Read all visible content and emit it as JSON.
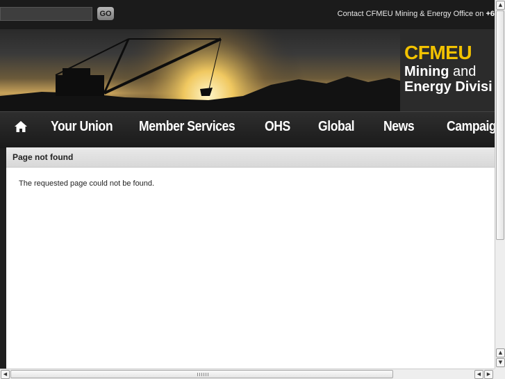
{
  "topbar": {
    "search_placeholder": "",
    "go_label": "GO",
    "contact_text": "Contact CFMEU Mining & Energy Office on ",
    "contact_phone": "+6"
  },
  "banner": {
    "logo_main": "CFMEU",
    "logo_line1_bold": "Mining",
    "logo_line1_rest": " and",
    "logo_line2": "Energy Divisi"
  },
  "nav": {
    "home_icon": "home-icon",
    "items": [
      "Your Union",
      "Member Services",
      "OHS",
      "Global",
      "News",
      "Campaig"
    ]
  },
  "content": {
    "title": "Page not found",
    "message": "The requested page could not be found."
  },
  "colors": {
    "accent": "#f2c200",
    "dark": "#1f1f1f"
  }
}
